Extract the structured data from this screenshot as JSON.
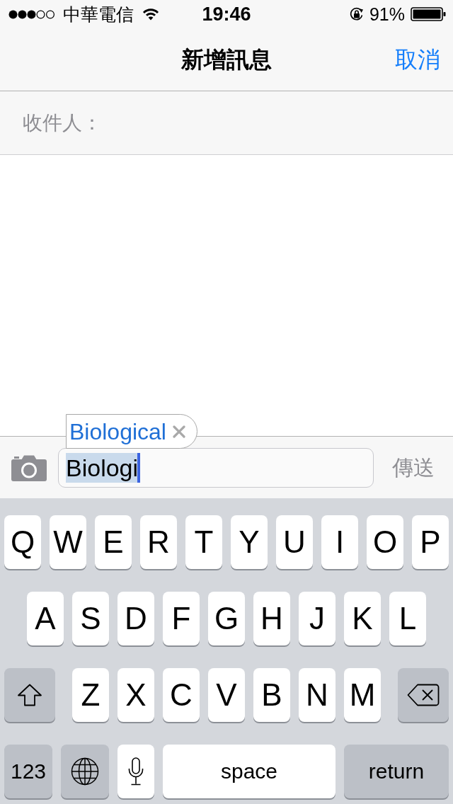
{
  "status_bar": {
    "carrier": "中華電信",
    "time": "19:46",
    "battery": "91%"
  },
  "nav_bar": {
    "title": "新增訊息",
    "cancel": "取消"
  },
  "recipient_field": {
    "label": "收件人："
  },
  "compose": {
    "value": "Biologi",
    "marked": true,
    "suggestion": "Biological",
    "send_button": {
      "label": "傳送",
      "disabled": true
    }
  },
  "keyboard": {
    "rows": [
      {
        "keys": [
          {
            "kind": "letter",
            "label": "Q"
          },
          {
            "kind": "letter",
            "label": "W"
          },
          {
            "kind": "letter",
            "label": "E"
          },
          {
            "kind": "letter",
            "label": "R"
          },
          {
            "kind": "letter",
            "label": "T"
          },
          {
            "kind": "letter",
            "label": "Y"
          },
          {
            "kind": "letter",
            "label": "U"
          },
          {
            "kind": "letter",
            "label": "I"
          },
          {
            "kind": "letter",
            "label": "O"
          },
          {
            "kind": "letter",
            "label": "P"
          }
        ]
      },
      {
        "keys": [
          {
            "kind": "letter",
            "label": "A"
          },
          {
            "kind": "letter",
            "label": "S"
          },
          {
            "kind": "letter",
            "label": "D"
          },
          {
            "kind": "letter",
            "label": "F"
          },
          {
            "kind": "letter",
            "label": "G"
          },
          {
            "kind": "letter",
            "label": "H"
          },
          {
            "kind": "letter",
            "label": "J"
          },
          {
            "kind": "letter",
            "label": "K"
          },
          {
            "kind": "letter",
            "label": "L"
          }
        ]
      },
      {
        "keys": [
          {
            "kind": "shift"
          },
          {
            "kind": "letter",
            "label": "Z"
          },
          {
            "kind": "letter",
            "label": "X"
          },
          {
            "kind": "letter",
            "label": "C"
          },
          {
            "kind": "letter",
            "label": "V"
          },
          {
            "kind": "letter",
            "label": "B"
          },
          {
            "kind": "letter",
            "label": "N"
          },
          {
            "kind": "letter",
            "label": "M"
          },
          {
            "kind": "delete"
          }
        ]
      },
      {
        "keys": [
          {
            "kind": "mode",
            "label": "123"
          },
          {
            "kind": "globe"
          },
          {
            "kind": "mic"
          },
          {
            "kind": "space",
            "label": "space"
          },
          {
            "kind": "return",
            "label": "return"
          }
        ]
      }
    ]
  }
}
